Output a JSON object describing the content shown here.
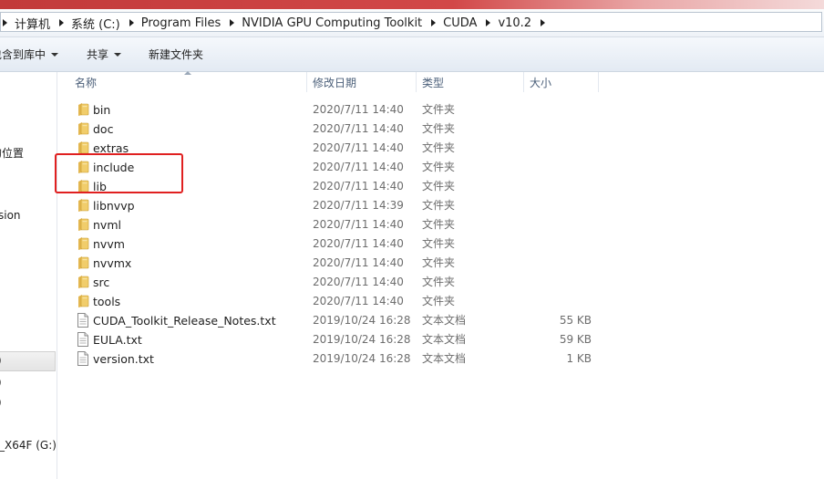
{
  "address_bar": {
    "crumbs": [
      "计算机",
      "系统 (C:)",
      "Program Files",
      "NVIDIA GPU Computing Toolkit",
      "CUDA",
      "v10.2"
    ]
  },
  "toolbar": {
    "include_in_library": "包含到库中",
    "share": "共享",
    "new_folder": "新建文件夹"
  },
  "nav_pane": {
    "items": [
      "的位置",
      "sion",
      ")",
      ")",
      ")",
      "_X64F (G:)"
    ]
  },
  "columns": {
    "name": "名称",
    "date_modified": "修改日期",
    "type": "类型",
    "size": "大小"
  },
  "files": [
    {
      "name": "bin",
      "date": "2020/7/11 14:40",
      "type": "文件夹",
      "size": "",
      "icon": "folder-icon"
    },
    {
      "name": "doc",
      "date": "2020/7/11 14:40",
      "type": "文件夹",
      "size": "",
      "icon": "folder-icon"
    },
    {
      "name": "extras",
      "date": "2020/7/11 14:40",
      "type": "文件夹",
      "size": "",
      "icon": "folder-icon"
    },
    {
      "name": "include",
      "date": "2020/7/11 14:40",
      "type": "文件夹",
      "size": "",
      "icon": "folder-icon"
    },
    {
      "name": "lib",
      "date": "2020/7/11 14:40",
      "type": "文件夹",
      "size": "",
      "icon": "folder-icon"
    },
    {
      "name": "libnvvp",
      "date": "2020/7/11 14:39",
      "type": "文件夹",
      "size": "",
      "icon": "folder-icon"
    },
    {
      "name": "nvml",
      "date": "2020/7/11 14:40",
      "type": "文件夹",
      "size": "",
      "icon": "folder-icon"
    },
    {
      "name": "nvvm",
      "date": "2020/7/11 14:40",
      "type": "文件夹",
      "size": "",
      "icon": "folder-icon"
    },
    {
      "name": "nvvmx",
      "date": "2020/7/11 14:40",
      "type": "文件夹",
      "size": "",
      "icon": "folder-icon"
    },
    {
      "name": "src",
      "date": "2020/7/11 14:40",
      "type": "文件夹",
      "size": "",
      "icon": "folder-icon"
    },
    {
      "name": "tools",
      "date": "2020/7/11 14:40",
      "type": "文件夹",
      "size": "",
      "icon": "folder-icon"
    },
    {
      "name": "CUDA_Toolkit_Release_Notes.txt",
      "date": "2019/10/24 16:28",
      "type": "文本文档",
      "size": "55 KB",
      "icon": "text-file-icon"
    },
    {
      "name": "EULA.txt",
      "date": "2019/10/24 16:28",
      "type": "文本文档",
      "size": "59 KB",
      "icon": "text-file-icon"
    },
    {
      "name": "version.txt",
      "date": "2019/10/24 16:28",
      "type": "文本文档",
      "size": "1 KB",
      "icon": "text-file-icon"
    }
  ],
  "highlight_color": "#e02020"
}
